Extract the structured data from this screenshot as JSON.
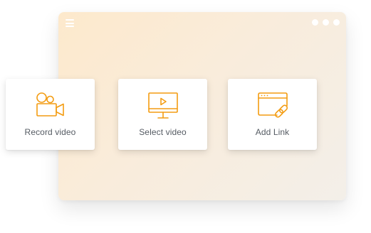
{
  "colors": {
    "accent": "#f39c12",
    "label": "#555b63",
    "card_bg": "#ffffff"
  },
  "window": {
    "menu_icon": "hamburger-icon",
    "controls": [
      "dot",
      "dot",
      "dot"
    ]
  },
  "cards": [
    {
      "label": "Record video",
      "icon": "video-camera-icon"
    },
    {
      "label": "Select video",
      "icon": "monitor-play-icon"
    },
    {
      "label": "Add Link",
      "icon": "browser-link-icon"
    }
  ]
}
